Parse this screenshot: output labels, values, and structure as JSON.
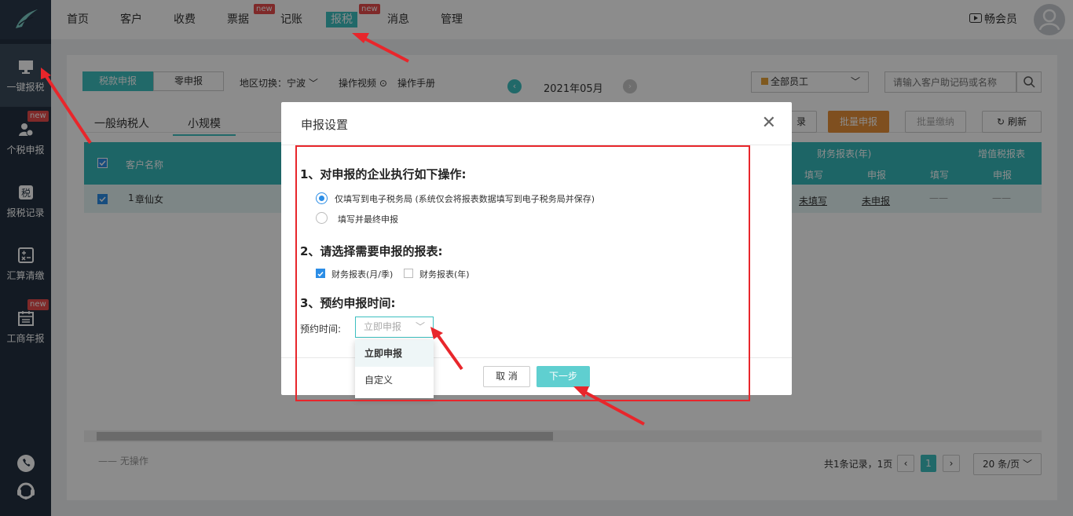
{
  "sidebar": {
    "items": [
      {
        "label": "一键报税",
        "icon": "monitor-icon"
      },
      {
        "label": "个税申报",
        "icon": "user-tax-icon",
        "badge": "new"
      },
      {
        "label": "报税记录",
        "icon": "tax-record-icon"
      },
      {
        "label": "汇算清缴",
        "icon": "calculator-icon"
      },
      {
        "label": "工商年报",
        "icon": "calendar-icon",
        "badge": "new"
      }
    ]
  },
  "nav": {
    "items": [
      {
        "label": "首页"
      },
      {
        "label": "客户"
      },
      {
        "label": "收费"
      },
      {
        "label": "票据",
        "badge": "new"
      },
      {
        "label": "记账"
      },
      {
        "label": "报税",
        "badge": "new"
      },
      {
        "label": "消息"
      },
      {
        "label": "管理"
      }
    ],
    "member": "畅会员"
  },
  "toolbar": {
    "tab_tax": "税款申报",
    "tab_zero": "零申报",
    "region": "地区切换：宁波",
    "video": "操作视频",
    "manual": "操作手册",
    "period": "2021年05月",
    "staff": "全部员工",
    "search_placeholder": "请输入客户助记码或名称"
  },
  "subtabs": {
    "general": "一般纳税人",
    "small": "小规模"
  },
  "actions": {
    "record": "录",
    "batch_declare": "批量申报",
    "batch_pay": "批量缴纳",
    "refresh": "刷新"
  },
  "table": {
    "col_name": "客户名称",
    "group_fin": "财务报表(年)",
    "group_vat": "增值税报表",
    "fill": "填写",
    "declare": "申报",
    "row": {
      "index": "1",
      "name": "章仙女",
      "fin_fill": "未填写",
      "fin_declare": "未申报",
      "vat_fill": "——",
      "vat_declare": "——"
    }
  },
  "footer": {
    "no_op": "—— 无操作",
    "total": "共1条记录，1页",
    "page": "1",
    "page_size": "20 条/页"
  },
  "modal": {
    "title": "申报设置",
    "sec1": "1、对申报的企业执行如下操作:",
    "opt1": "仅填写到电子税务局 (系统仅会将报表数据填写到电子税务局并保存)",
    "opt2": "填写并最终申报",
    "sec2": "2、请选择需要申报的报表:",
    "cb1": "财务报表(月/季)",
    "cb2": "财务报表(年)",
    "sec3": "3、预约申报时间:",
    "time_label": "预约时间:",
    "time_value": "立即申报",
    "dropdown": [
      "立即申报",
      "自定义"
    ],
    "cancel": "取 消",
    "next": "下一步"
  }
}
